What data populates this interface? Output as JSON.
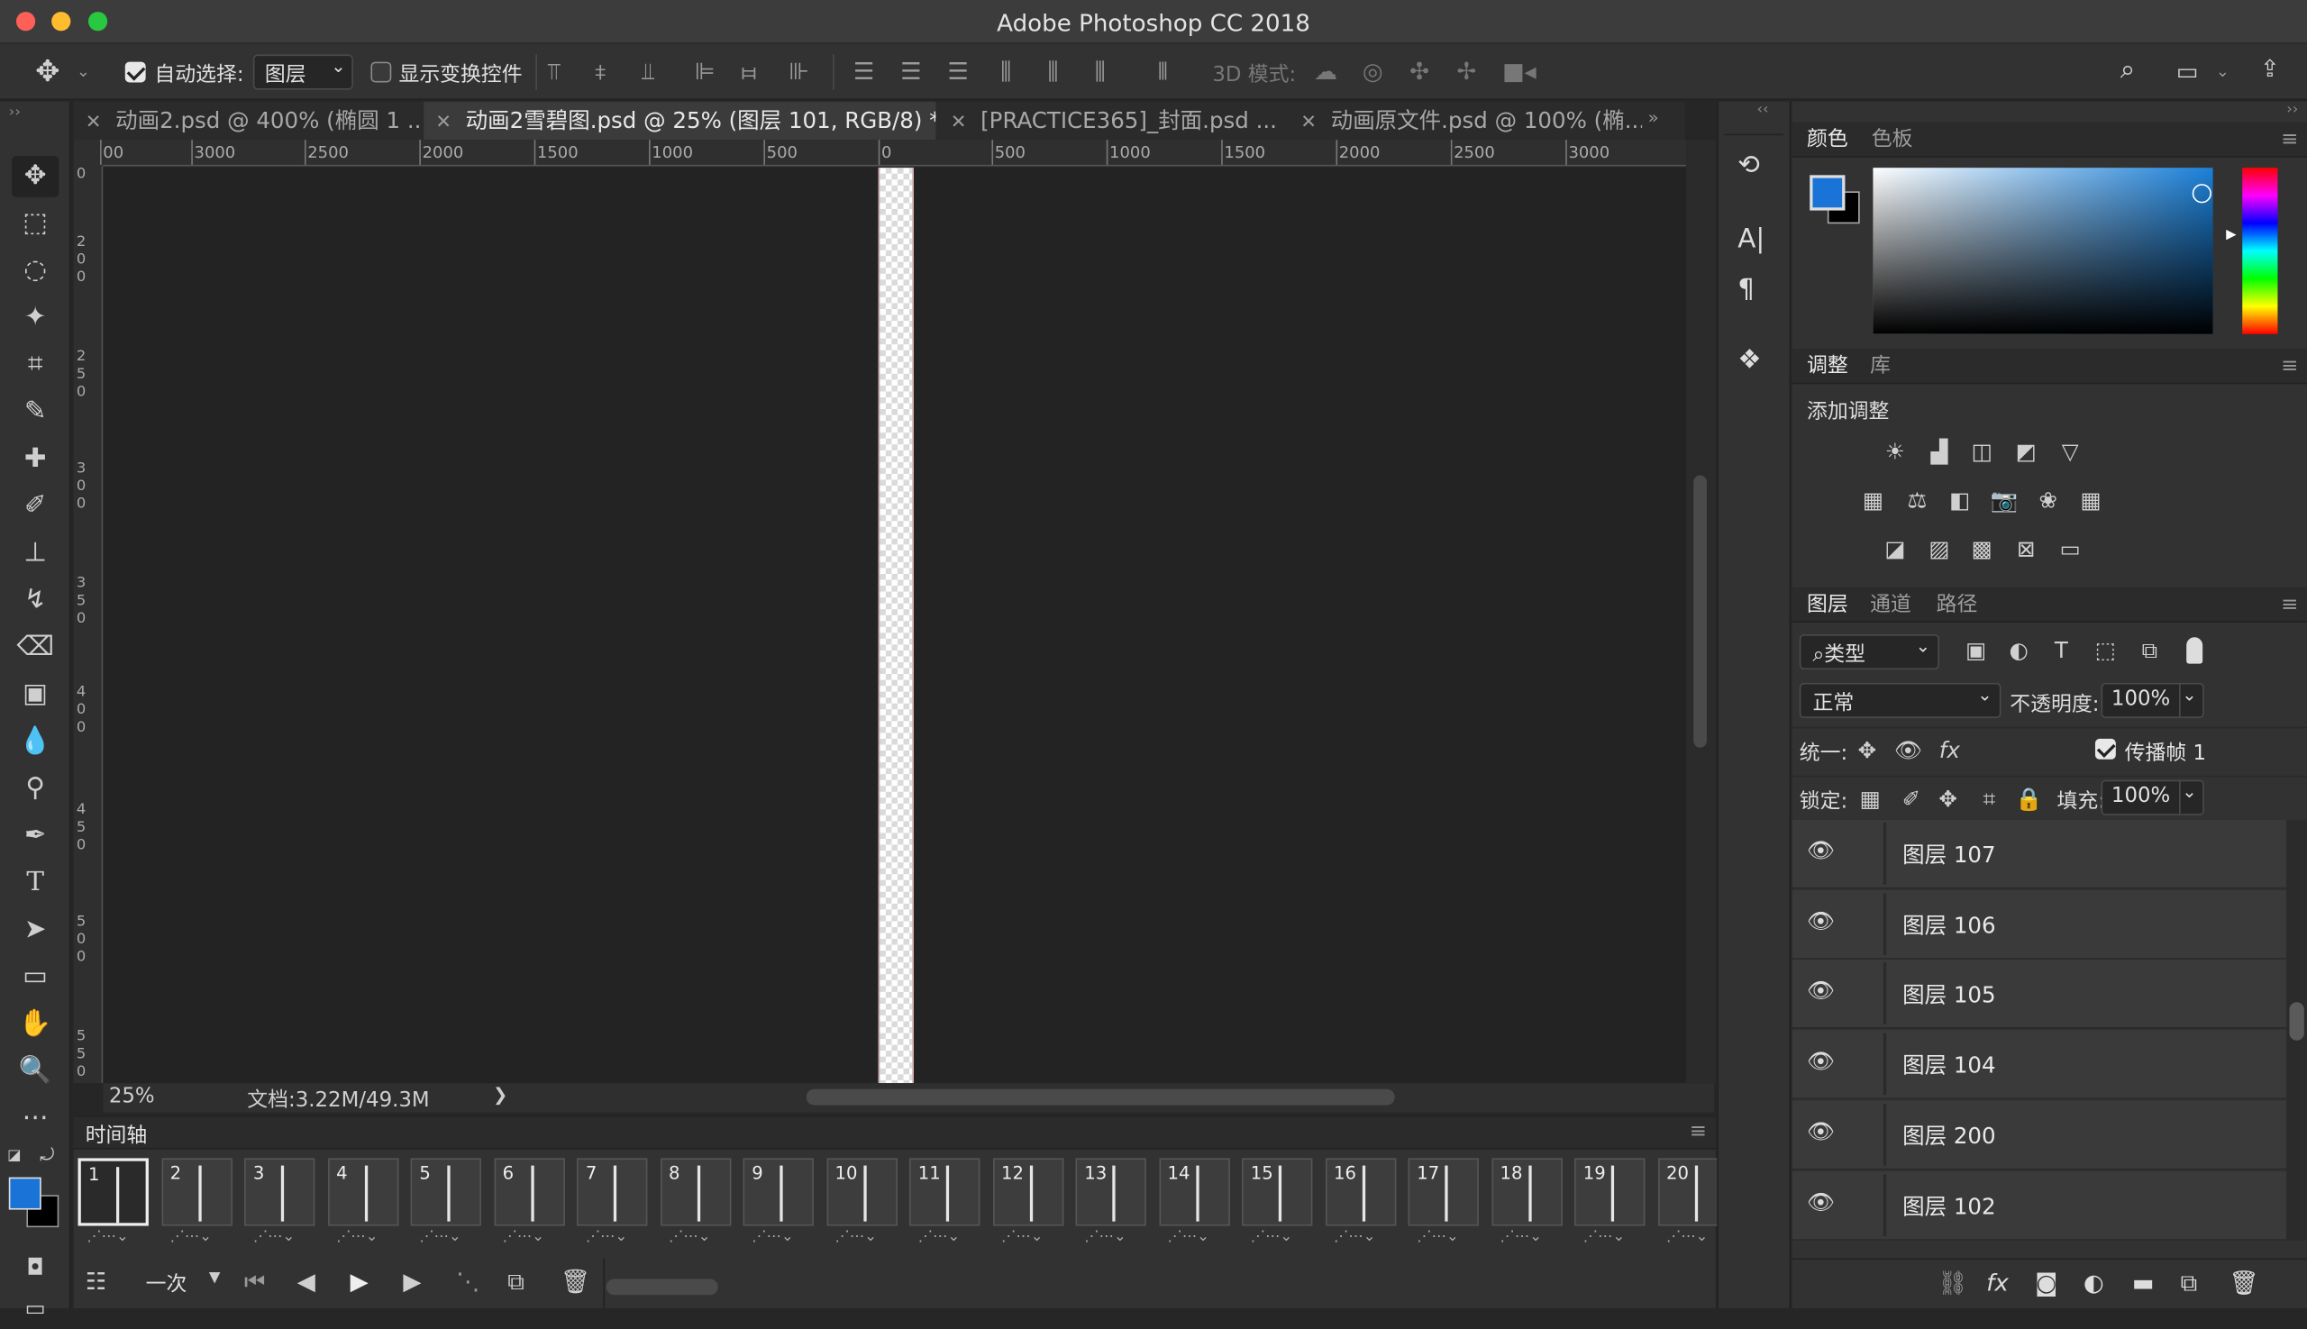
{
  "app_title": "Adobe Photoshop CC 2018",
  "options": {
    "auto_select_label": "自动选择:",
    "auto_select_target": "图层",
    "show_transform_label": "显示变换控件",
    "mode3d_label": "3D 模式:"
  },
  "tabs": [
    {
      "label": "动画2.psd @ 400% (椭圆 1 ..."
    },
    {
      "label": "动画2雪碧图.psd @ 25% (图层 101, RGB/8) *"
    },
    {
      "label": "[PRACTICE365]_封面.psd ..."
    },
    {
      "label": "动画原文件.psd @ 100% (椭..."
    }
  ],
  "ruler": {
    "h_ticks": [
      "00",
      "3000",
      "2500",
      "2000",
      "1500",
      "1000",
      "500",
      "0",
      "500",
      "1000",
      "1500",
      "2000",
      "2500",
      "3000"
    ],
    "v_ticks": [
      "0",
      "2\n0\n0",
      "2\n5\n0",
      "3\n0\n0",
      "3\n5\n0",
      "4\n0\n0",
      "4\n5\n0",
      "5\n0\n0",
      "5\n5\n0"
    ]
  },
  "status": {
    "zoom": "25%",
    "doc": "文档:3.22M/49.3M",
    "arrow": "❯"
  },
  "timeline": {
    "title": "时间轴",
    "frames": [
      "1",
      "2",
      "3",
      "4",
      "5",
      "6",
      "7",
      "8",
      "9",
      "10",
      "11",
      "12",
      "13",
      "14",
      "15",
      "16",
      "17",
      "18",
      "19",
      "20"
    ],
    "loop": "一次"
  },
  "color_panel": {
    "tab_color": "颜色",
    "tab_swatches": "色板",
    "fg_color": "#1a73d6",
    "bg_color": "#000000"
  },
  "adjust_panel": {
    "tab_adjust": "调整",
    "tab_library": "库",
    "add_label": "添加调整"
  },
  "layers_panel": {
    "tab_layers": "图层",
    "tab_channels": "通道",
    "tab_paths": "路径",
    "filter_kind": "类型",
    "blend_mode": "正常",
    "opacity_label": "不透明度:",
    "opacity_value": "100%",
    "unify_label": "统一:",
    "propagate_label": "传播帧 1",
    "lock_label": "锁定:",
    "fill_label": "填充:",
    "fill_value": "100%",
    "layers": [
      "图层 107",
      "图层 106",
      "图层 105",
      "图层 104",
      "图层 200",
      "图层 102"
    ]
  }
}
